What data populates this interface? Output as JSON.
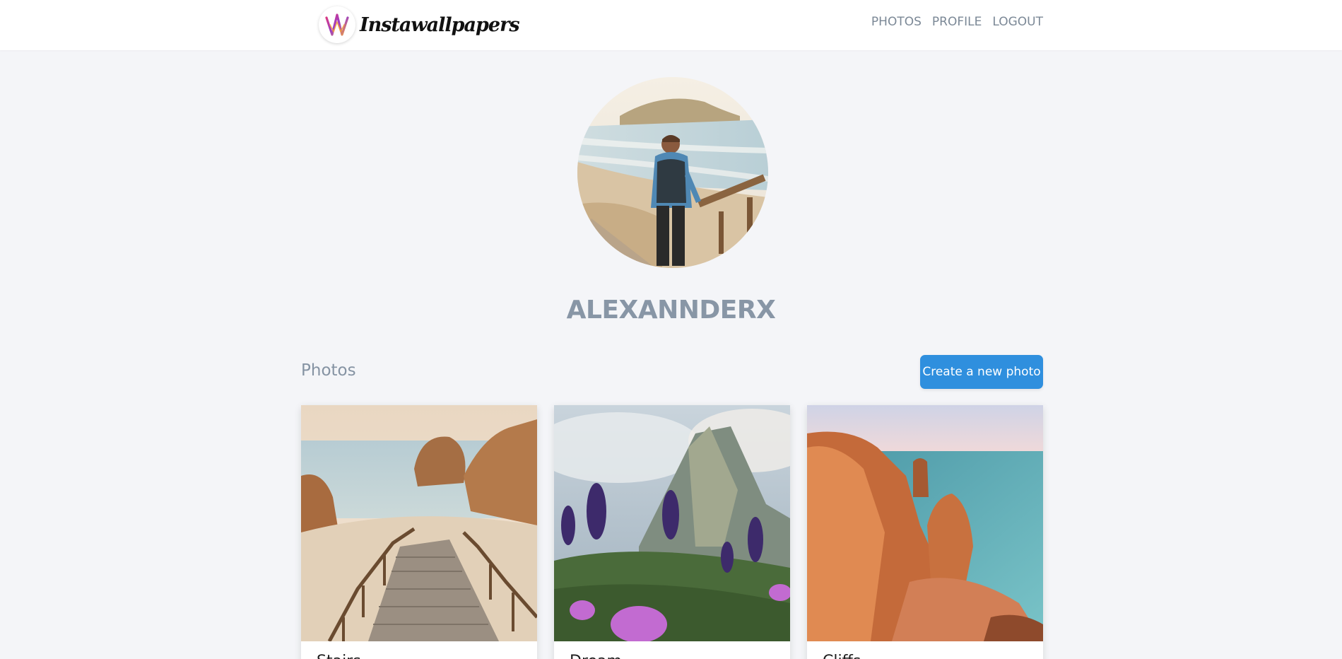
{
  "brand": {
    "name": "Instawallpapers",
    "logo_icon": "instawallpapers-logo-icon"
  },
  "nav": {
    "items": [
      {
        "label": "PHOTOS"
      },
      {
        "label": "PROFILE"
      },
      {
        "label": "LOGOUT"
      }
    ]
  },
  "profile": {
    "username": "ALEXANNDERX",
    "avatar_icon": "user-avatar-image"
  },
  "photos_section": {
    "title": "Photos",
    "create_label": "Create a new photo"
  },
  "photos": [
    {
      "title": "Stairs",
      "image": "beach-stairs-photo"
    },
    {
      "title": "Dream",
      "image": "mountain-flowers-photo"
    },
    {
      "title": "Cliffs",
      "image": "coastal-cliffs-photo"
    }
  ],
  "colors": {
    "background": "#f4f5f8",
    "navbar": "#ffffff",
    "nav_text": "#7b8896",
    "username": "#8896a6",
    "primary_button": "#2f8fde"
  }
}
